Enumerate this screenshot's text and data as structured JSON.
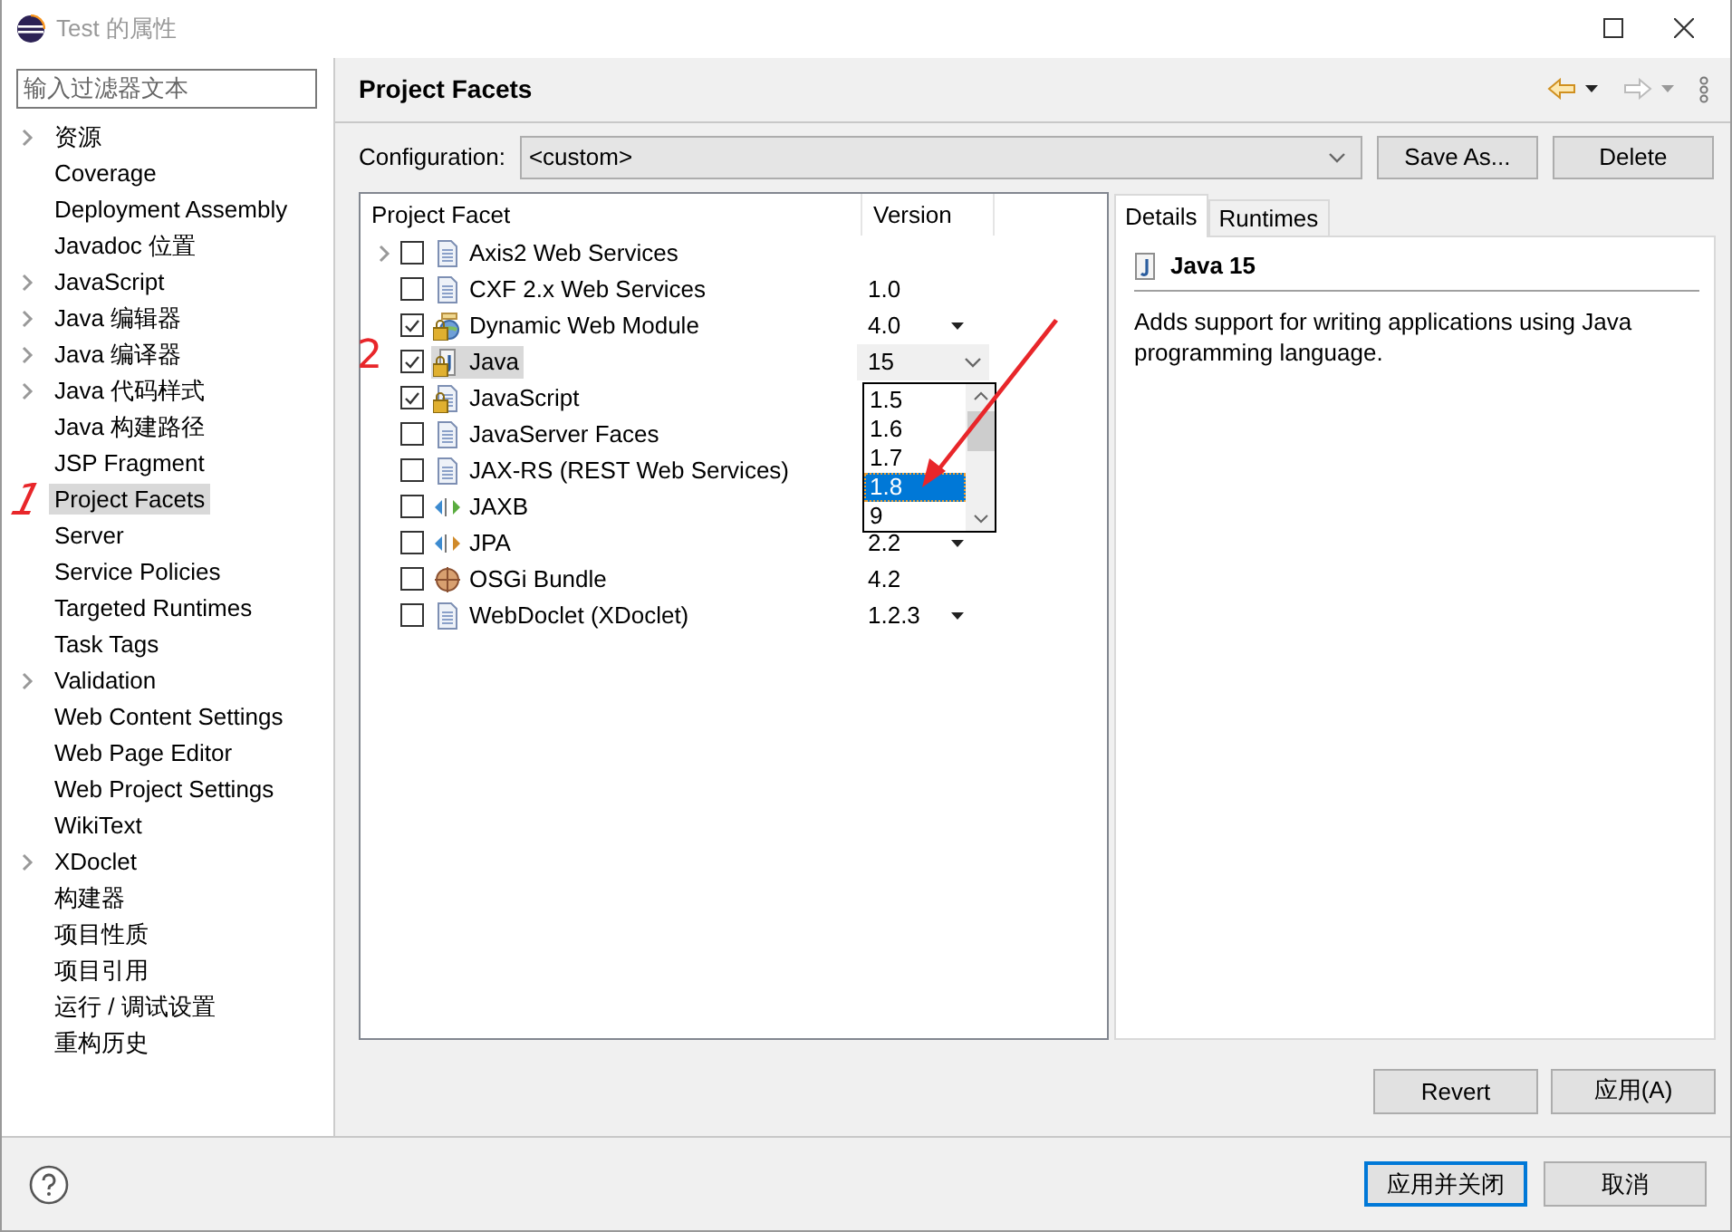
{
  "window": {
    "title": "Test 的属性"
  },
  "filter": {
    "placeholder": "输入过滤器文本"
  },
  "sidebar": {
    "items": [
      {
        "label": "资源",
        "expandable": true,
        "selected": false
      },
      {
        "label": "Coverage",
        "expandable": false,
        "selected": false
      },
      {
        "label": "Deployment Assembly",
        "expandable": false,
        "selected": false
      },
      {
        "label": "Javadoc 位置",
        "expandable": false,
        "selected": false
      },
      {
        "label": "JavaScript",
        "expandable": true,
        "selected": false
      },
      {
        "label": "Java 编辑器",
        "expandable": true,
        "selected": false
      },
      {
        "label": "Java 编译器",
        "expandable": true,
        "selected": false
      },
      {
        "label": "Java 代码样式",
        "expandable": true,
        "selected": false
      },
      {
        "label": "Java 构建路径",
        "expandable": false,
        "selected": false
      },
      {
        "label": "JSP Fragment",
        "expandable": false,
        "selected": false
      },
      {
        "label": "Project Facets",
        "expandable": false,
        "selected": true
      },
      {
        "label": "Server",
        "expandable": false,
        "selected": false
      },
      {
        "label": "Service Policies",
        "expandable": false,
        "selected": false
      },
      {
        "label": "Targeted Runtimes",
        "expandable": false,
        "selected": false
      },
      {
        "label": "Task Tags",
        "expandable": false,
        "selected": false
      },
      {
        "label": "Validation",
        "expandable": true,
        "selected": false
      },
      {
        "label": "Web Content Settings",
        "expandable": false,
        "selected": false
      },
      {
        "label": "Web Page Editor",
        "expandable": false,
        "selected": false
      },
      {
        "label": "Web Project Settings",
        "expandable": false,
        "selected": false
      },
      {
        "label": "WikiText",
        "expandable": false,
        "selected": false
      },
      {
        "label": "XDoclet",
        "expandable": true,
        "selected": false
      },
      {
        "label": "构建器",
        "expandable": false,
        "selected": false
      },
      {
        "label": "项目性质",
        "expandable": false,
        "selected": false
      },
      {
        "label": "项目引用",
        "expandable": false,
        "selected": false
      },
      {
        "label": "运行 / 调试设置",
        "expandable": false,
        "selected": false
      },
      {
        "label": "重构历史",
        "expandable": false,
        "selected": false
      }
    ]
  },
  "page": {
    "title": "Project Facets"
  },
  "configuration": {
    "label": "Configuration:",
    "value": "<custom>",
    "buttons": [
      "Save As...",
      "Delete"
    ]
  },
  "table": {
    "columns": [
      "Project Facet",
      "Version"
    ],
    "rows": [
      {
        "name": "Axis2 Web Services",
        "expandable": true,
        "checked": false,
        "locked": false,
        "selected": false
      },
      {
        "name": "CXF 2.x Web Services",
        "expandable": false,
        "checked": false,
        "locked": false,
        "selected": false,
        "version": "1.0",
        "kind": "plain"
      },
      {
        "name": "Dynamic Web Module",
        "expandable": false,
        "checked": true,
        "locked": true,
        "selected": false,
        "version": "4.0",
        "kind": "dropdown"
      },
      {
        "name": "Java",
        "expandable": false,
        "checked": true,
        "locked": true,
        "selected": true,
        "version": "15",
        "kind": "combo"
      },
      {
        "name": "JavaScript",
        "expandable": false,
        "checked": true,
        "locked": true,
        "selected": false
      },
      {
        "name": "JavaServer Faces",
        "expandable": false,
        "checked": false,
        "locked": false,
        "selected": false
      },
      {
        "name": "JAX-RS (REST Web Services)",
        "expandable": false,
        "checked": false,
        "locked": false,
        "selected": false
      },
      {
        "name": "JAXB",
        "expandable": false,
        "checked": false,
        "locked": false,
        "selected": false
      },
      {
        "name": "JPA",
        "expandable": false,
        "checked": false,
        "locked": false,
        "selected": false,
        "version": "2.2",
        "kind": "dropdown"
      },
      {
        "name": "OSGi Bundle",
        "expandable": false,
        "checked": false,
        "locked": false,
        "selected": false,
        "version": "4.2",
        "kind": "plain"
      },
      {
        "name": "WebDoclet (XDoclet)",
        "expandable": false,
        "checked": false,
        "locked": false,
        "selected": false,
        "version": "1.2.3",
        "kind": "dropdown"
      }
    ]
  },
  "version_list": {
    "items": [
      {
        "label": "1.5",
        "selected": false
      },
      {
        "label": "1.6",
        "selected": false
      },
      {
        "label": "1.7",
        "selected": false
      },
      {
        "label": "1.8",
        "selected": true
      },
      {
        "label": "9",
        "selected": false
      }
    ]
  },
  "details": {
    "tabs": [
      {
        "label": "Details",
        "selected": true
      },
      {
        "label": "Runtimes",
        "selected": false
      }
    ],
    "title": "Java 15",
    "description": "Adds support for writing applications using Java programming language."
  },
  "page_buttons": [
    "Revert",
    "应用(A)"
  ],
  "footer": {
    "buttons": [
      {
        "label": "应用并关闭",
        "default": true
      },
      {
        "label": "取消",
        "default": false
      }
    ]
  },
  "annotations": [
    {
      "text": "1"
    },
    {
      "text": "2"
    }
  ]
}
